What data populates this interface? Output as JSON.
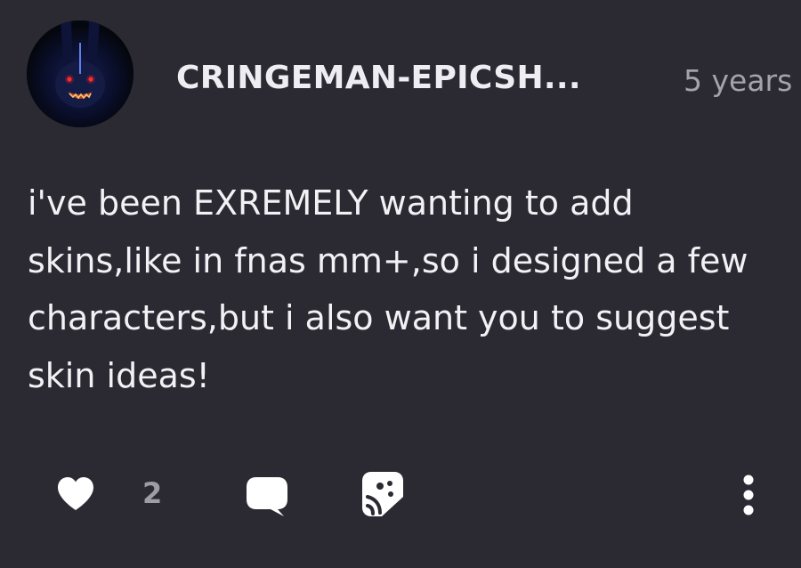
{
  "post": {
    "author": "CRINGEMAN-EPICSH...",
    "timestamp": "5 years",
    "body": "i've been EXREMELY wanting to add skins,like in fnas mm+,so i designed a few characters,but i also want you to suggest skin ideas!",
    "like_count": "2"
  },
  "icons": {
    "avatar": "user-avatar",
    "like": "heart-icon",
    "comment": "speech-bubble-icon",
    "sticker": "sticker-icon",
    "more": "vertical-dots-icon"
  },
  "colors": {
    "background": "#2b2a33",
    "text": "#f2f2f5",
    "muted": "#a4a3ab",
    "icon": "#ffffff"
  }
}
